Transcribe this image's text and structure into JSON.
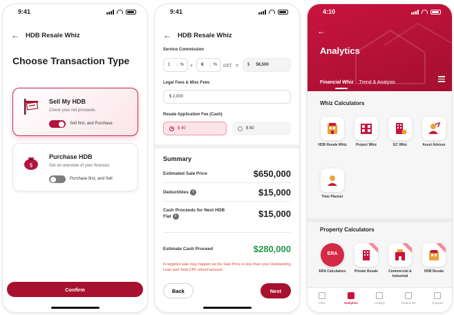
{
  "colors": {
    "brand": "#a8102f",
    "brand_light": "#fde4e8",
    "success": "#1e9a43",
    "warning": "#e0452f"
  },
  "screen1": {
    "status_time": "9:41",
    "title": "HDB Resale Whiz",
    "heading": "Choose Transaction Type",
    "cards": [
      {
        "title": "Sell My HDB",
        "desc": "Check your net proceeds",
        "toggle_label": "Sell first, and Purchase",
        "toggle_on": true,
        "icon": "sold-sign-icon"
      },
      {
        "title": "Purchase HDB",
        "desc": "Get an overview of your finances",
        "toggle_label": "Purchase first, and Sell",
        "toggle_on": false,
        "icon": "money-bag-icon"
      }
    ],
    "confirm": "Confirm"
  },
  "screen2": {
    "status_time": "9:41",
    "title": "HDB Resale Whiz",
    "service_commission_label": "Service Commission",
    "commission": {
      "qty": "1",
      "unit": "%",
      "plus": "+",
      "gst_value": "8",
      "gst_unit": "%",
      "gst_label": "GST",
      "equals": "=",
      "currency": "$",
      "result": "56,500"
    },
    "legal_label": "Legal Fees & Misc Fees",
    "legal_value": "$ 2,000",
    "app_fee_label": "Resale Application Fee (Cash)",
    "fee_options": [
      "$ 40",
      "$ 80"
    ],
    "summary_title": "Summary",
    "summary": [
      {
        "label": "Estimated Sale Price",
        "value": "$650,000"
      },
      {
        "label": "Deductibles",
        "value": "$15,000"
      },
      {
        "label": "Cash Proceeds for Next HDB Flat",
        "value": "$15,000"
      }
    ],
    "estimate_label": "Estimate Cash Proceed",
    "estimate_value": "$280,000",
    "warning": "A negative sale may happen as the Sale Price is less than your Outstanding Loan and Total CPF refund amount.",
    "back": "Back",
    "next": "Next"
  },
  "screen3": {
    "status_time": "4:10",
    "title": "Analytics",
    "tabs": [
      "Financial Whiz",
      "Trend & Analysis"
    ],
    "whiz_title": "Whiz Calculators",
    "whiz": [
      "HDB Resale Whiz",
      "Project Whiz",
      "EC Whiz",
      "Asset Advisor",
      "Time Planner"
    ],
    "property_title": "Property Calculators",
    "property": [
      "ERA Calculators",
      "Private Resale",
      "Commercial & Industrial",
      "HDB Resale"
    ],
    "era_logo": "ERA",
    "nav": [
      "Suite",
      "Analytics",
      "Listings",
      "Enterprise",
      "Support"
    ]
  }
}
